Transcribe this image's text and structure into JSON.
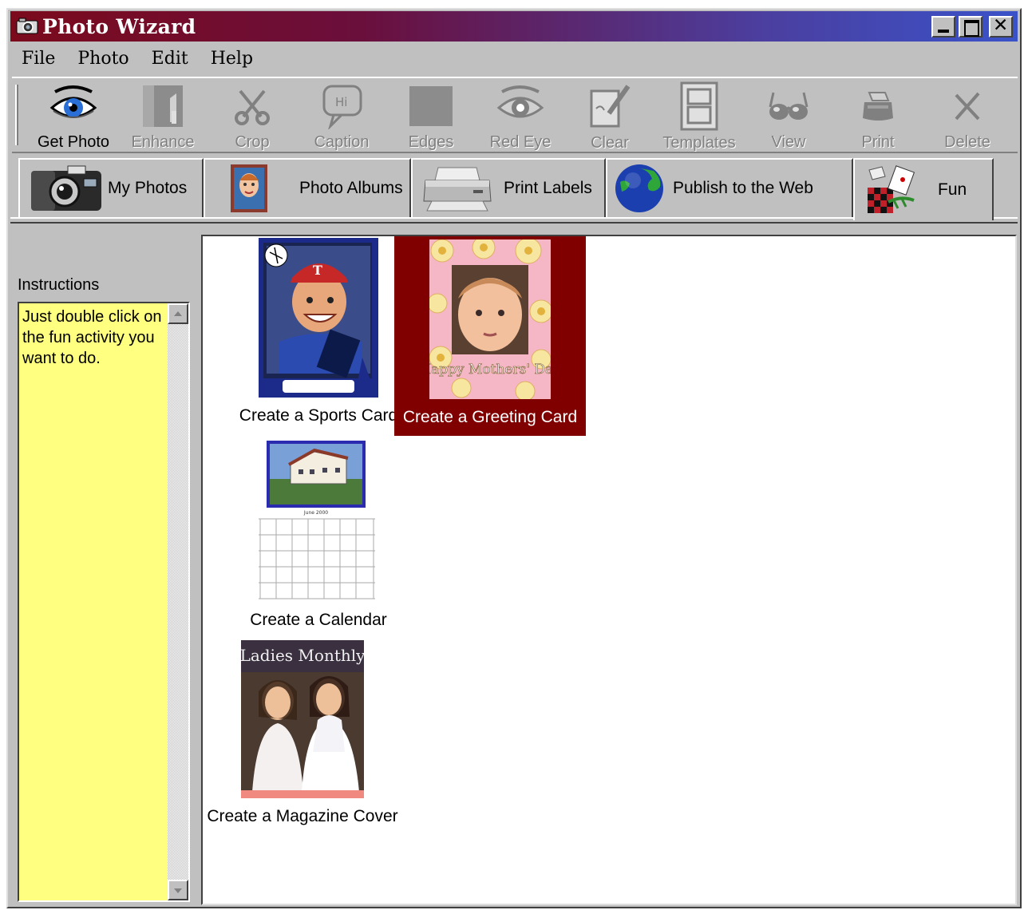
{
  "window": {
    "title": "Photo Wizard"
  },
  "titlebar_buttons": {
    "minimize": "minimize-icon",
    "maximize": "maximize-icon",
    "close": "close-icon",
    "close_glyph": "✕"
  },
  "menu": [
    "File",
    "Photo",
    "Edit",
    "Help"
  ],
  "toolbar": [
    {
      "label": "Get Photo",
      "icon": "eye-icon",
      "enabled": true
    },
    {
      "label": "Enhance",
      "icon": "enhance-icon",
      "enabled": false
    },
    {
      "label": "Crop",
      "icon": "scissors-icon",
      "enabled": false
    },
    {
      "label": "Caption",
      "icon": "speech-bubble-icon",
      "enabled": false
    },
    {
      "label": "Edges",
      "icon": "edges-icon",
      "enabled": false
    },
    {
      "label": "Red Eye",
      "icon": "red-eye-icon",
      "enabled": false
    },
    {
      "label": "Clear",
      "icon": "clear-icon",
      "enabled": false
    },
    {
      "label": "Templates",
      "icon": "templates-icon",
      "enabled": false
    },
    {
      "label": "View",
      "icon": "glasses-icon",
      "enabled": false
    },
    {
      "label": "Print",
      "icon": "printer-icon",
      "enabled": false
    },
    {
      "label": "Delete",
      "icon": "delete-icon",
      "enabled": false
    }
  ],
  "tabs": [
    {
      "label": "My Photos",
      "icon": "camera-icon"
    },
    {
      "label": "Photo Albums",
      "icon": "album-photo-icon"
    },
    {
      "label": "Print Labels",
      "icon": "printer-icon"
    },
    {
      "label": "Publish to the Web",
      "icon": "globe-icon"
    },
    {
      "label": "Fun",
      "icon": "fun-icon",
      "active": true
    }
  ],
  "instructions": {
    "label": "Instructions",
    "text": "Just double click on the fun activity you want to do."
  },
  "activities": [
    {
      "caption": "Create a Sports Card",
      "selected": false
    },
    {
      "caption": "Create a Greeting Card",
      "selected": true,
      "card_text": "Happy Mothers' Day"
    },
    {
      "caption": "Create a Calendar",
      "selected": false,
      "month": "June 2000"
    },
    {
      "caption": "Create a Magazine Cover",
      "selected": false,
      "masthead": "Ladies Monthly"
    }
  ],
  "colors": {
    "selection": "#800000",
    "instructions_bg": "#ffff80",
    "face": "#c0c0c0"
  }
}
